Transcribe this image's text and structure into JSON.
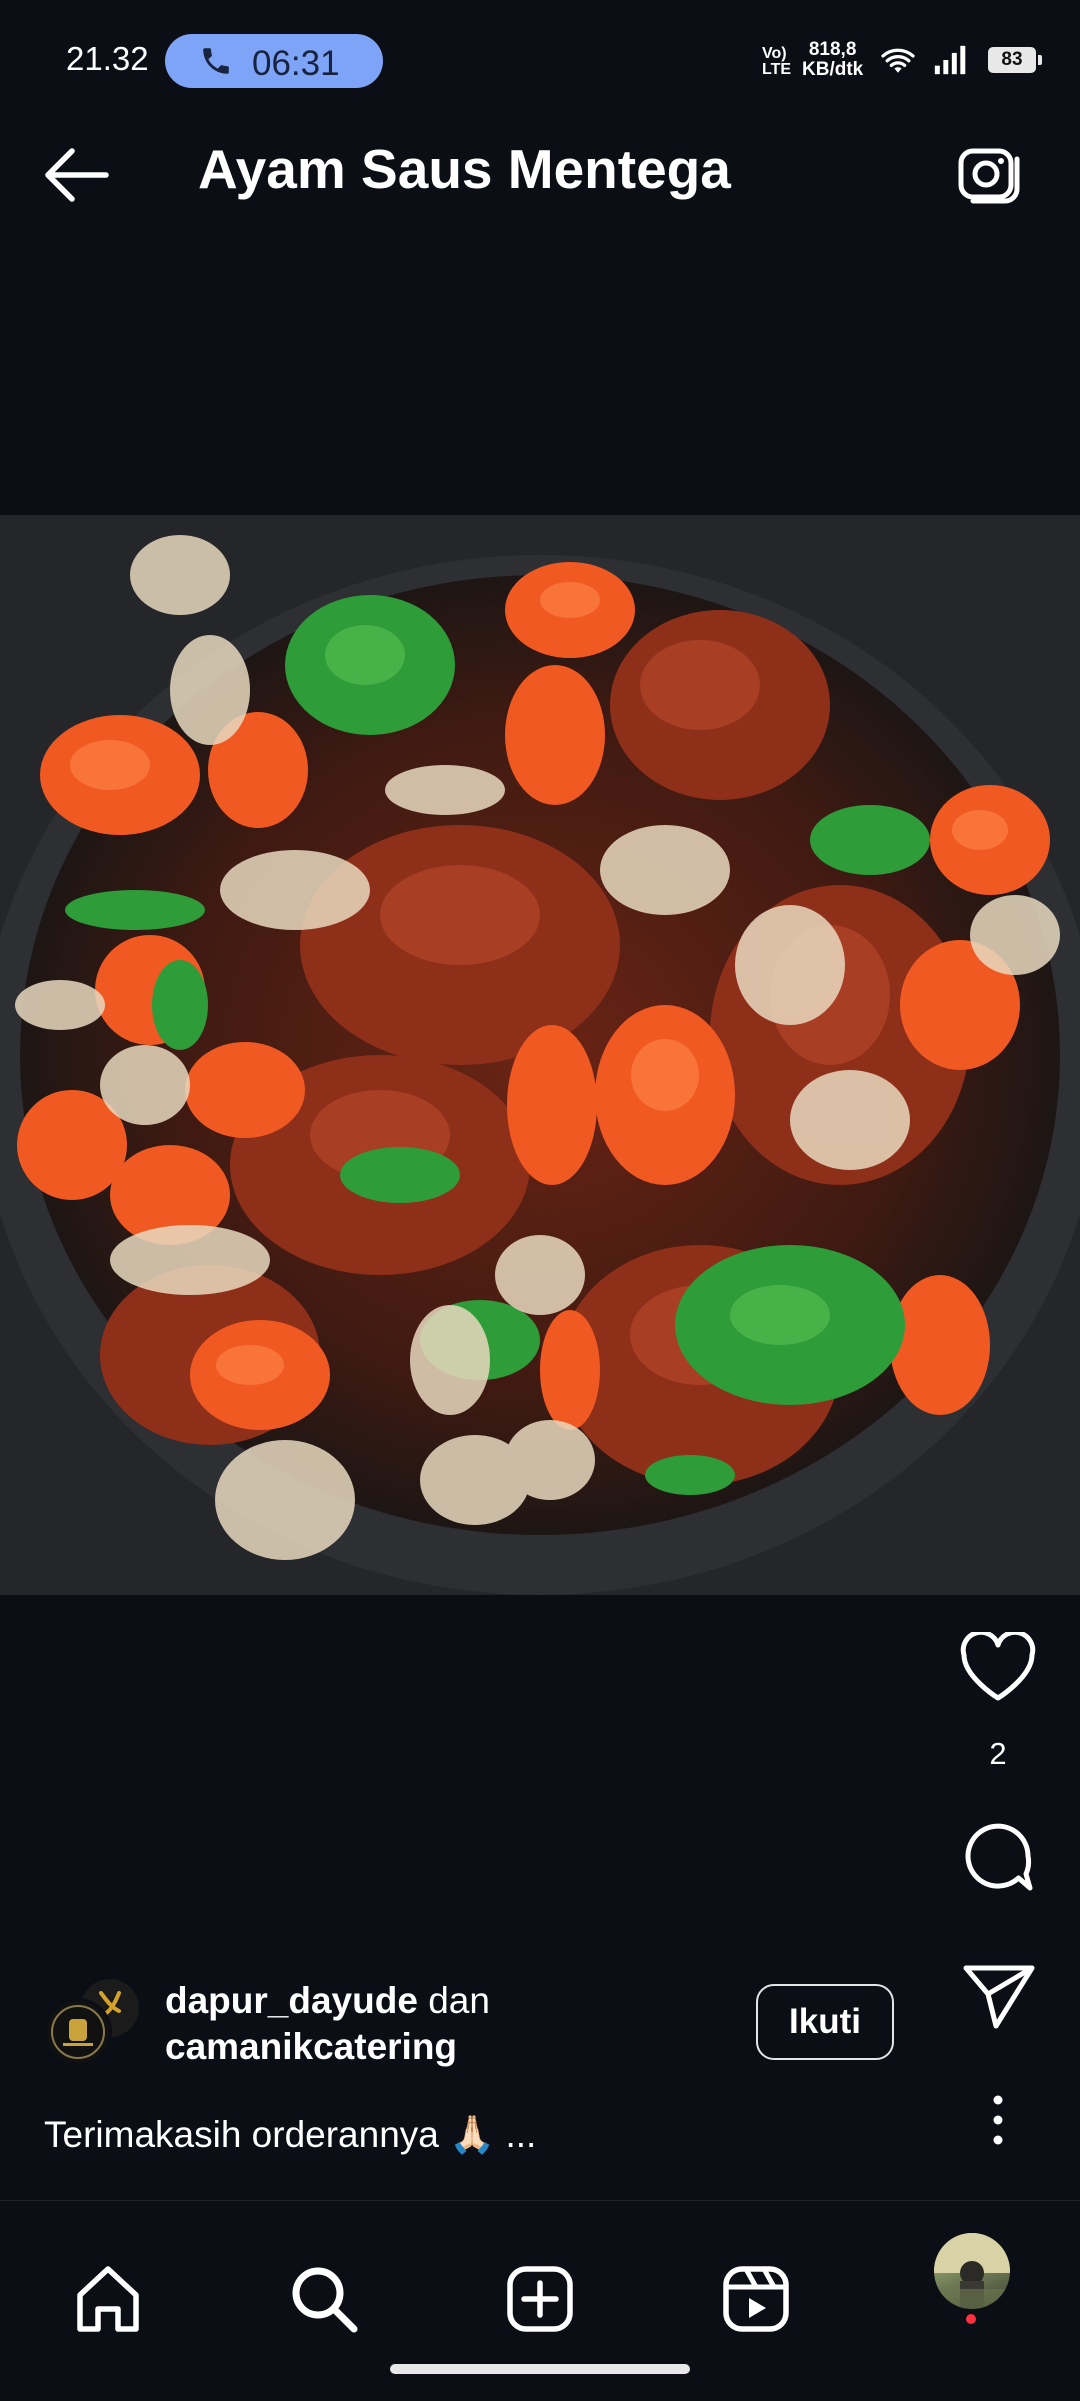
{
  "status_bar": {
    "time": "21.32",
    "call_timer": "06:31",
    "volte": "Vo) LTE",
    "speed_value": "818,8",
    "speed_unit": "KB/dtk",
    "battery": "83"
  },
  "header": {
    "title": "Ayam Saus Mentega",
    "back_icon": "arrow-left-icon",
    "camera_icon": "camera-icon"
  },
  "post": {
    "image_alt": "photo",
    "like_count": "2",
    "author_1": "dapur_dayude",
    "connector": "dan",
    "author_2": "camanikcatering",
    "follow_label": "Ikuti",
    "caption": "Terimakasih orderannya 🙏🏻 ..."
  },
  "nav": {
    "items": [
      "home-icon",
      "search-icon",
      "create-icon",
      "reels-icon",
      "profile-avatar"
    ]
  },
  "colors": {
    "background": "#0b0e14",
    "call_pill": "#7ea4f7",
    "notification_dot": "#ff3040"
  }
}
